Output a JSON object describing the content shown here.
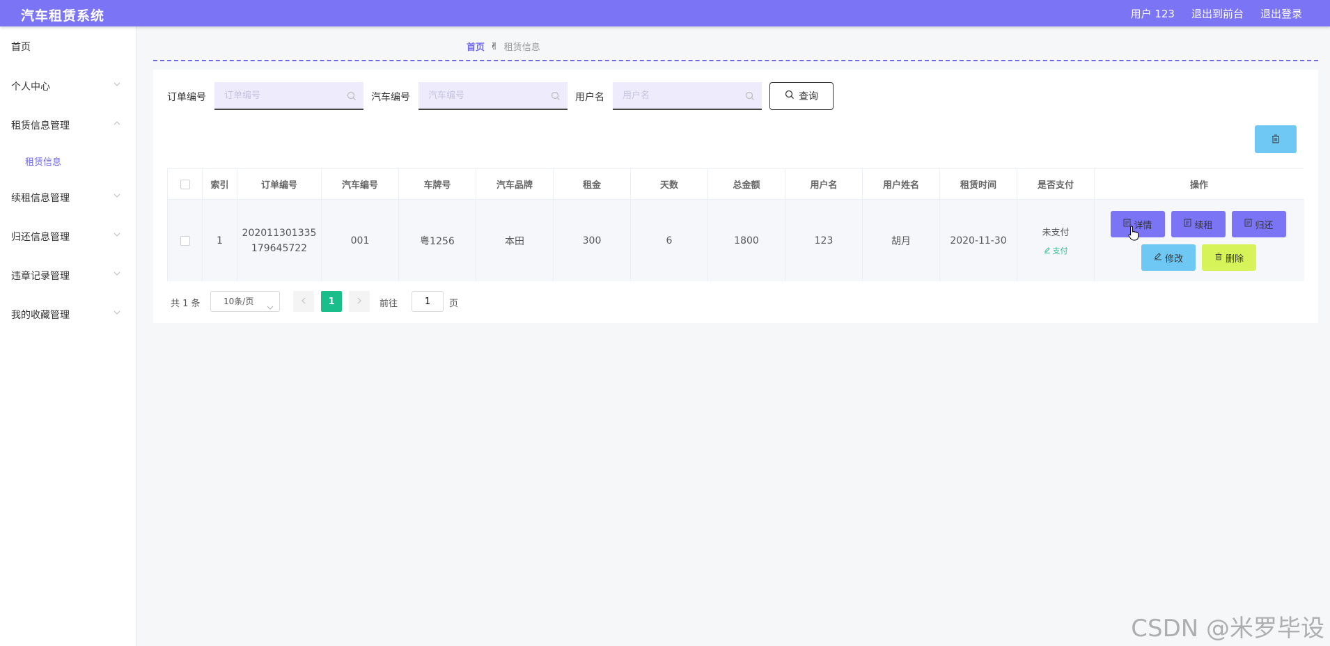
{
  "header": {
    "title": "汽车租赁系统",
    "user": "用户 123",
    "front_link": "退出到前台",
    "logout": "退出登录"
  },
  "sidebar": {
    "items": [
      {
        "label": "首页"
      },
      {
        "label": "个人中心"
      },
      {
        "label": "租赁信息管理"
      },
      {
        "label": "租赁信息"
      },
      {
        "label": "续租信息管理"
      },
      {
        "label": "归还信息管理"
      },
      {
        "label": "违章记录管理"
      },
      {
        "label": "我的收藏管理"
      }
    ]
  },
  "breadcrumb": {
    "home": "首页",
    "current": "租赁信息"
  },
  "search": {
    "order_label": "订单编号",
    "order_placeholder": "订单编号",
    "car_label": "汽车编号",
    "car_placeholder": "汽车编号",
    "user_label": "用户名",
    "user_placeholder": "用户名",
    "query_button": "查询"
  },
  "table": {
    "columns": [
      "索引",
      "订单编号",
      "汽车编号",
      "车牌号",
      "汽车品牌",
      "租金",
      "天数",
      "总金额",
      "用户名",
      "用户姓名",
      "租赁时间",
      "是否支付",
      "操作"
    ],
    "rows": [
      {
        "index": "1",
        "order_no_line1": "202011301335",
        "order_no_line2": "179645722",
        "car_no": "001",
        "plate": "粤1256",
        "brand": "本田",
        "rent": "300",
        "days": "6",
        "total": "1800",
        "username": "123",
        "name": "胡月",
        "rent_time": "2020-11-30",
        "pay_status": "未支付",
        "pay_action": "支付"
      }
    ],
    "actions": {
      "detail": "详情",
      "renew": "续租",
      "return": "归还",
      "edit": "修改",
      "delete": "删除"
    }
  },
  "pagination": {
    "total": "共 1 条",
    "page_size": "10条/页",
    "current_page": "1",
    "goto_label": "前往",
    "goto_value": "1",
    "page_suffix": "页"
  },
  "watermark": "CSDN @米罗毕设",
  "colors": {
    "primary": "#7b74f5",
    "info": "#6fc8f4",
    "lime": "#d6f45a",
    "success": "#19be8a"
  }
}
